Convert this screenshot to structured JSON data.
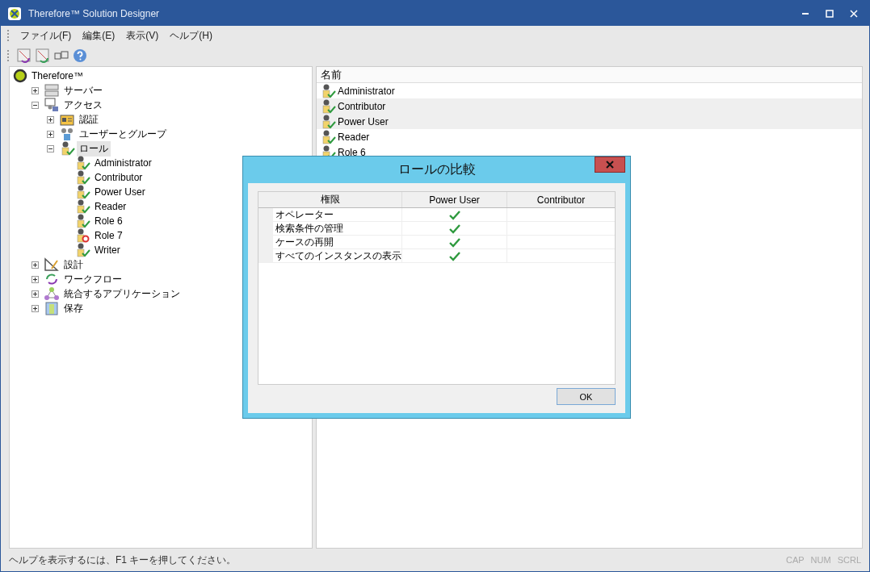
{
  "window": {
    "title": "Therefore™ Solution Designer"
  },
  "menu": [
    {
      "label": "ファイル(F)"
    },
    {
      "label": "編集(E)"
    },
    {
      "label": "表示(V)"
    },
    {
      "label": "ヘルプ(H)"
    }
  ],
  "toolbar": [
    {
      "kind": "compare"
    },
    {
      "kind": "compare-alt"
    },
    {
      "kind": "translate"
    },
    {
      "kind": "help"
    }
  ],
  "tree": {
    "label": "Therefore™",
    "kind": "root",
    "children": [
      {
        "label": "サーバー",
        "kind": "server",
        "expanded": false,
        "selected": false
      },
      {
        "label": "アクセス",
        "kind": "access",
        "expanded": true,
        "selected": false,
        "children": [
          {
            "label": "認証",
            "kind": "auth",
            "expanded": false,
            "selected": false
          },
          {
            "label": "ユーザーとグループ",
            "kind": "users",
            "expanded": false,
            "selected": false
          },
          {
            "label": "ロール",
            "kind": "role",
            "expanded": true,
            "selected": true,
            "children": [
              {
                "label": "Administrator",
                "kind": "role",
                "selected": false
              },
              {
                "label": "Contributor",
                "kind": "role",
                "selected": false
              },
              {
                "label": "Power User",
                "kind": "role",
                "selected": false
              },
              {
                "label": "Reader",
                "kind": "role",
                "selected": false
              },
              {
                "label": "Role 6",
                "kind": "role",
                "selected": false
              },
              {
                "label": "Role 7",
                "kind": "role-disabled",
                "selected": false
              },
              {
                "label": "Writer",
                "kind": "role",
                "selected": false
              }
            ]
          }
        ]
      },
      {
        "label": "設計",
        "kind": "design",
        "expanded": false,
        "selected": false
      },
      {
        "label": "ワークフロー",
        "kind": "workflow",
        "expanded": false,
        "selected": false
      },
      {
        "label": "統合するアプリケーション",
        "kind": "integration",
        "expanded": false,
        "selected": false
      },
      {
        "label": "保存",
        "kind": "storage",
        "expanded": false,
        "selected": false
      }
    ]
  },
  "list": {
    "column": "名前",
    "rows": [
      {
        "label": "Administrator",
        "selected": false
      },
      {
        "label": "Contributor",
        "selected": true
      },
      {
        "label": "Power User",
        "selected": true
      },
      {
        "label": "Reader",
        "selected": false
      },
      {
        "label": "Role 6",
        "selected": false
      }
    ]
  },
  "dialog": {
    "title": "ロールの比較",
    "columns": [
      "権限",
      "Power User",
      "Contributor"
    ],
    "rows": [
      {
        "label": "オペレーター",
        "granted": [
          true,
          false
        ]
      },
      {
        "label": "検索条件の管理",
        "granted": [
          true,
          false
        ]
      },
      {
        "label": "ケースの再開",
        "granted": [
          true,
          false
        ]
      },
      {
        "label": "すべてのインスタンスの表示",
        "granted": [
          true,
          false
        ]
      }
    ],
    "ok": "OK"
  },
  "status_bar": {
    "text": "ヘルプを表示するには、F1 キーを押してください。",
    "indicators": [
      "CAP",
      "NUM",
      "SCRL"
    ]
  }
}
